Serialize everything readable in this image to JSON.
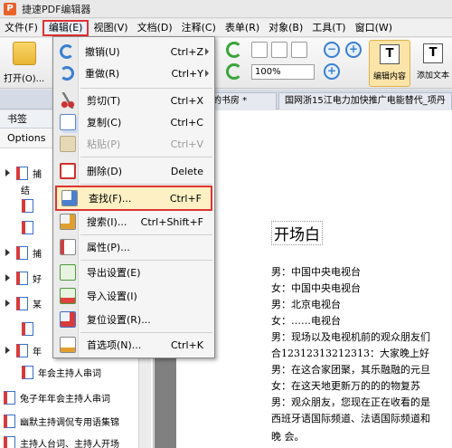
{
  "app": {
    "title": "捷速PDF编辑器",
    "logo_letter": "P"
  },
  "menubar": {
    "items": [
      "文件(F)",
      "编辑(E)",
      "视图(V)",
      "文档(D)",
      "注释(C)",
      "表单(R)",
      "对象(B)",
      "工具(T)",
      "窗口(W)"
    ]
  },
  "toolbar": {
    "open_label": "打开(O)...",
    "zoom_value": "100%",
    "edit_content_label": "编辑内容",
    "add_text_label": "添加文本"
  },
  "tabs": [
    "的书房 *",
    "国网浙15江电力加快推广电能替代_项丹"
  ],
  "left_panel": {
    "header": "书签",
    "options_label": "Options",
    "bookmarks": [
      {
        "label": "捕",
        "sub": "结"
      },
      {
        "label": "捕"
      },
      {
        "label": "好"
      },
      {
        "label": "某"
      },
      {
        "label": "年"
      },
      {
        "label": "年会主持人串词"
      },
      {
        "label": "兔子年年会主持人串词"
      },
      {
        "label": "幽默主持调侃专用语集锦"
      },
      {
        "label": "主持人台词、主持人开场"
      }
    ]
  },
  "edit_menu": {
    "items": [
      {
        "label": "撤销(U)",
        "shortcut": "Ctrl+Z",
        "icon": "undo-icon"
      },
      {
        "label": "重做(R)",
        "shortcut": "Ctrl+Y",
        "icon": "redo-icon"
      },
      {
        "label": "剪切(T)",
        "shortcut": "Ctrl+X",
        "icon": "cut-icon"
      },
      {
        "label": "复制(C)",
        "shortcut": "Ctrl+C",
        "icon": "copy-icon"
      },
      {
        "label": "粘贴(P)",
        "shortcut": "Ctrl+V",
        "icon": "paste-icon",
        "disabled": true
      },
      {
        "label": "删除(D)",
        "shortcut": "Delete",
        "icon": "delete-icon"
      },
      {
        "label": "查找(F)...",
        "shortcut": "Ctrl+F",
        "icon": "find-icon",
        "highlight": true
      },
      {
        "label": "搜索(I)...",
        "shortcut": "Ctrl+Shift+F",
        "icon": "search-icon"
      },
      {
        "label": "属性(P)...",
        "shortcut": "",
        "icon": "properties-icon"
      },
      {
        "label": "导出设置(E)",
        "shortcut": "",
        "icon": "export-icon"
      },
      {
        "label": "导入设置(I)",
        "shortcut": "",
        "icon": "import-icon"
      },
      {
        "label": "复位设置(R)...",
        "shortcut": "",
        "icon": "reset-icon"
      },
      {
        "label": "首选项(N)...",
        "shortcut": "Ctrl+K",
        "icon": "preferences-icon"
      }
    ]
  },
  "document": {
    "title": "开场白",
    "lines": [
      "男：中国中央电视台",
      "女：中国中央电视台",
      "男：北京电视台",
      "女：……电视台",
      "男：现场以及电视机前的观众朋友们",
      "合12312313212313：大家晚上好",
      "男：在这合家团聚，其乐融融的元旦",
      "女：在这天地更新万的的的物复苏",
      "男：观众朋友，您现在正在收看的是",
      "西班牙语国际频道、法语国际频道和",
      "晚 会。"
    ]
  },
  "colors": {
    "highlight_border": "#e03232",
    "accent": "#3a7fd0"
  }
}
